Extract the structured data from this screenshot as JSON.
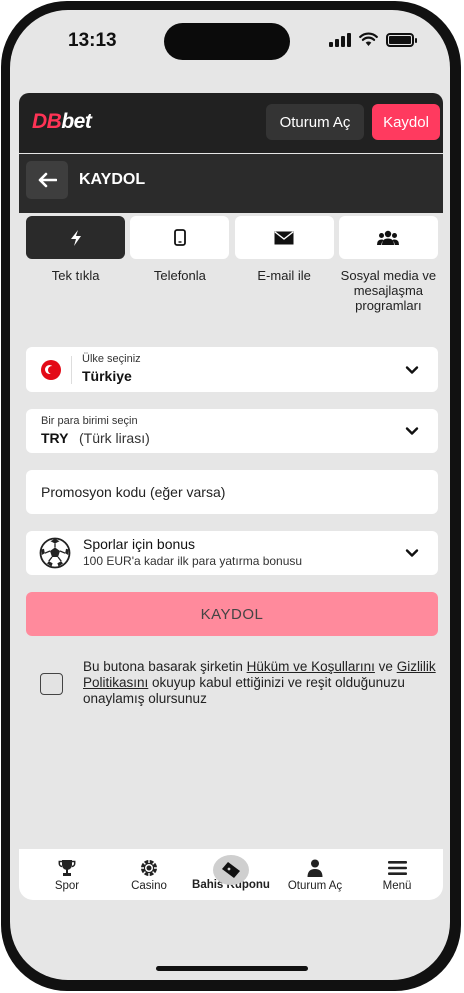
{
  "status_bar": {
    "time": "13:13"
  },
  "header": {
    "logo_prefix": "DB",
    "logo_suffix": "bet",
    "login_label": "Oturum Aç",
    "register_label": "Kaydol"
  },
  "subheader": {
    "back_icon": "arrow-left-icon",
    "title": "KAYDOL"
  },
  "methods": [
    {
      "label": "Tek tıkla",
      "icon": "lightning-icon",
      "active": true
    },
    {
      "label": "Telefonla",
      "icon": "phone-icon",
      "active": false
    },
    {
      "label": "E-mail ile",
      "icon": "envelope-icon",
      "active": false
    },
    {
      "label": "Sosyal media ve mesajlaşma programları",
      "icon": "people-icon",
      "active": false
    }
  ],
  "form": {
    "country": {
      "label": "Ülke seçiniz",
      "value": "Türkiye"
    },
    "currency": {
      "label": "Bir para birimi seçin",
      "code": "TRY",
      "name": "(Türk lirası)"
    },
    "promo": {
      "placeholder": "Promosyon kodu (eğer varsa)"
    },
    "bonus": {
      "title": "Sporlar için bonus",
      "subtitle": "100 EUR'a kadar ilk para yatırma bonusu"
    },
    "submit_label": "KAYDOL"
  },
  "terms": {
    "part1": "Bu butona basarak şirketin ",
    "link1": "Hüküm ve Koşullarını",
    "part2": " ve ",
    "link2": "Gizlilik Politikasını",
    "part3": " okuyup kabul ettiğinizi ve reşit olduğunuzu onaylamış olursunuz"
  },
  "bottom_nav": [
    {
      "label": "Spor",
      "icon": "trophy-icon",
      "active": false
    },
    {
      "label": "Casino",
      "icon": "chip-icon",
      "active": false
    },
    {
      "label": "Bahis Kuponu",
      "icon": "ticket-icon",
      "active": true
    },
    {
      "label": "Oturum Aç",
      "icon": "user-icon",
      "active": false
    },
    {
      "label": "Menü",
      "icon": "menu-icon",
      "active": false
    }
  ],
  "colors": {
    "accent": "#ff3a5f",
    "submit_disabled": "#ff8a9c",
    "header_bg": "#212121"
  }
}
